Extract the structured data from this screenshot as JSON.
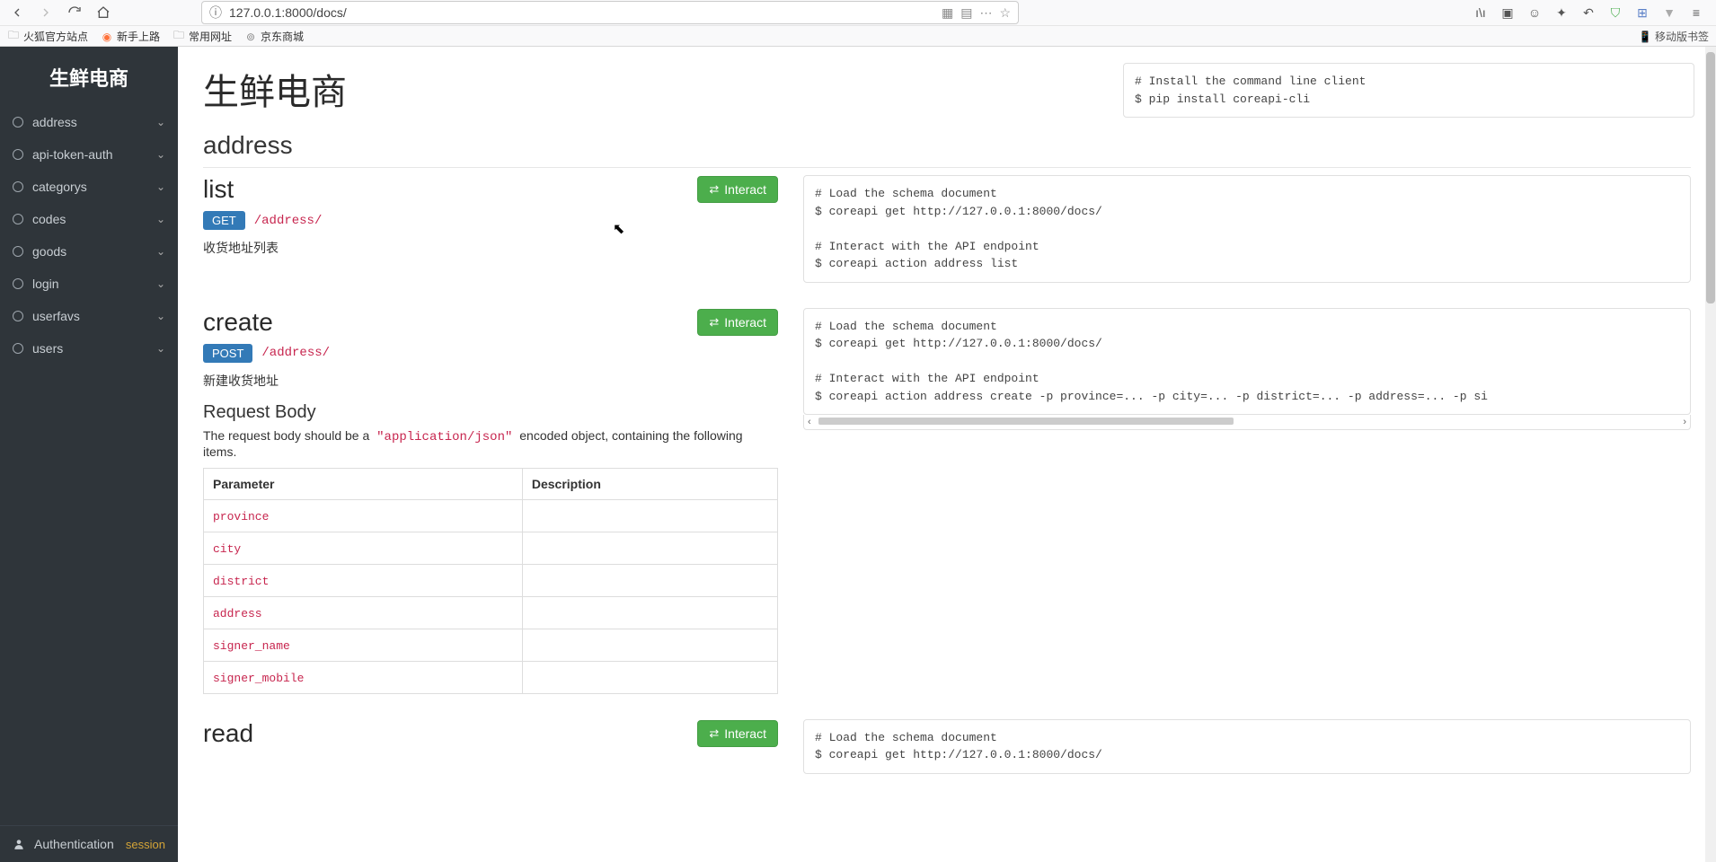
{
  "browser": {
    "url": "127.0.0.1:8000/docs/",
    "bookmarks": [
      {
        "label": "火狐官方站点",
        "icon": "folder"
      },
      {
        "label": "新手上路",
        "icon": "ff"
      },
      {
        "label": "常用网址",
        "icon": "folder"
      },
      {
        "label": "京东商城",
        "icon": "globe"
      }
    ],
    "mobile_label": "移动版书签"
  },
  "sidebar": {
    "title": "生鲜电商",
    "items": [
      {
        "label": "address"
      },
      {
        "label": "api-token-auth"
      },
      {
        "label": "categorys"
      },
      {
        "label": "codes"
      },
      {
        "label": "goods"
      },
      {
        "label": "login"
      },
      {
        "label": "userfavs"
      },
      {
        "label": "users"
      }
    ],
    "auth_label": "Authentication",
    "session_label": "session"
  },
  "page": {
    "title": "生鲜电商",
    "install_code": "# Install the command line client\n$ pip install coreapi-cli",
    "section": "address",
    "interact_label": "Interact",
    "params_header_param": "Parameter",
    "params_header_desc": "Description",
    "request_body_label": "Request Body",
    "body_note_prefix": "The request body should be a ",
    "body_note_code": "\"application/json\"",
    "body_note_suffix": " encoded object, containing the following items.",
    "ops": {
      "list": {
        "name": "list",
        "method": "GET",
        "path": "/address/",
        "desc": "收货地址列表",
        "code": "# Load the schema document\n$ coreapi get http://127.0.0.1:8000/docs/\n\n# Interact with the API endpoint\n$ coreapi action address list"
      },
      "create": {
        "name": "create",
        "method": "POST",
        "path": "/address/",
        "desc": "新建收货地址",
        "params": [
          {
            "name": "province",
            "desc": ""
          },
          {
            "name": "city",
            "desc": ""
          },
          {
            "name": "district",
            "desc": ""
          },
          {
            "name": "address",
            "desc": ""
          },
          {
            "name": "signer_name",
            "desc": ""
          },
          {
            "name": "signer_mobile",
            "desc": ""
          }
        ],
        "code": "# Load the schema document\n$ coreapi get http://127.0.0.1:8000/docs/\n\n# Interact with the API endpoint\n$ coreapi action address create -p province=... -p city=... -p district=... -p address=... -p si"
      },
      "read": {
        "name": "read",
        "code": "# Load the schema document\n$ coreapi get http://127.0.0.1:8000/docs/"
      }
    }
  }
}
